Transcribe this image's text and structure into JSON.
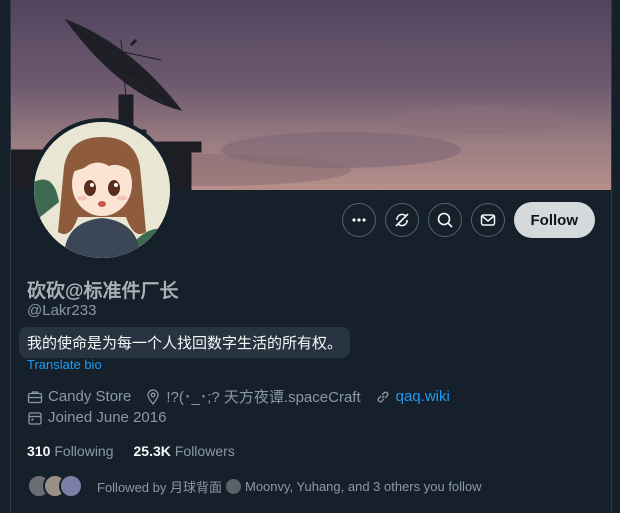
{
  "profile": {
    "display_name": "砍砍@标准件厂长",
    "handle": "@Lakr233",
    "bio": "我的使命是为每一个人找回数字生活的所有权。",
    "translate_label": "Translate bio",
    "category": "Candy Store",
    "location": "!?(･_･;? 天方夜谭.spaceCraft",
    "website": "qaq.wiki",
    "joined": "Joined June 2016"
  },
  "actions": {
    "more_icon": "more-horizontal-icon",
    "subscribe_icon": "notification-off-icon",
    "search_icon": "search-icon",
    "message_icon": "mail-icon",
    "follow_label": "Follow"
  },
  "stats": {
    "following_count": "310",
    "following_label": "Following",
    "followers_count": "25.3K",
    "followers_label": "Followers"
  },
  "followed_by": {
    "prefix": "Followed by 月球背面",
    "rest": "Moonvy, Yuhang, and 3 others you follow"
  },
  "colors": {
    "background": "#15202b",
    "accent": "#1d9bf0",
    "follow_button": "#d6d9db"
  }
}
